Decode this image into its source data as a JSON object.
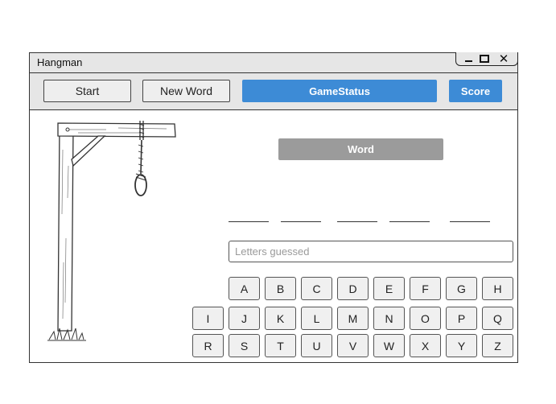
{
  "window": {
    "title": "Hangman",
    "controls": {
      "minimize_icon": "minimize-icon",
      "maximize_icon": "maximize-icon",
      "close_symbol": "✕"
    }
  },
  "toolbar": {
    "start_label": "Start",
    "new_word_label": "New Word",
    "game_status_label": "GameStatus",
    "score_label": "Score"
  },
  "game": {
    "word_label": "Word",
    "letter_blanks": [
      "",
      "",
      "",
      "",
      ""
    ],
    "guess_placeholder": "Letters guessed"
  },
  "keyboard": {
    "row1": [
      "A",
      "B",
      "C",
      "D",
      "E",
      "F",
      "G",
      "H"
    ],
    "row2": [
      "I",
      "J",
      "K",
      "L",
      "M",
      "N",
      "O",
      "P",
      "Q"
    ],
    "row3": [
      "R",
      "S",
      "T",
      "U",
      "V",
      "W",
      "X",
      "Y",
      "Z"
    ]
  },
  "colors": {
    "accent": "#3d8bd6",
    "word_box": "#9b9b9b",
    "toolbar_bg": "#e6e6e6"
  },
  "icons": {
    "gallows": "gallows-illustration"
  }
}
